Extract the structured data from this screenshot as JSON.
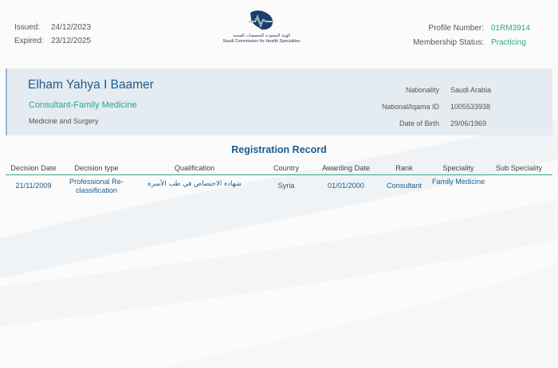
{
  "header": {
    "issued_label": "Issued:",
    "issued_value": "24/12/2023",
    "expired_label": "Expired:",
    "expired_value": "23/12/2025",
    "profile_number_label": "Profile Number:",
    "profile_number_value": "01RM3914",
    "membership_status_label": "Membership Status:",
    "membership_status_value": "Practicing"
  },
  "logo": {
    "arabic_text": "الهيئة السعودية للتخصصات الصحية",
    "english_text": "Saudi Commission for Health Specialties"
  },
  "profile": {
    "name": "Elham Yahya I Baamer",
    "specialty": "Consultant-Family Medicine",
    "department": "Medicine and Surgery",
    "nationality_label": "Nationality",
    "nationality_value": "Saudi Arabia",
    "id_label": "National/Iqama ID",
    "id_value": "1005533938",
    "dob_label": "Date of Birth",
    "dob_value": "29/06/1969"
  },
  "registration": {
    "title": "Registration Record",
    "columns": [
      "Decision Date",
      "Decision type",
      "Qualification",
      "Country",
      "Awarding Date",
      "Rank",
      "Speciality",
      "Sub Speciality"
    ],
    "rows": [
      [
        "21/11/2009",
        "Professional Re-classification",
        "شهادة الاختصاص في طب الأسرة",
        "Syria",
        "01/01/2000",
        "Consultant",
        "Family Medicine",
        ""
      ]
    ]
  },
  "colors": {
    "brand_blue": "#1d5c8e",
    "accent_green": "#2fa58a",
    "panel_bg": "#e4ebf1"
  }
}
